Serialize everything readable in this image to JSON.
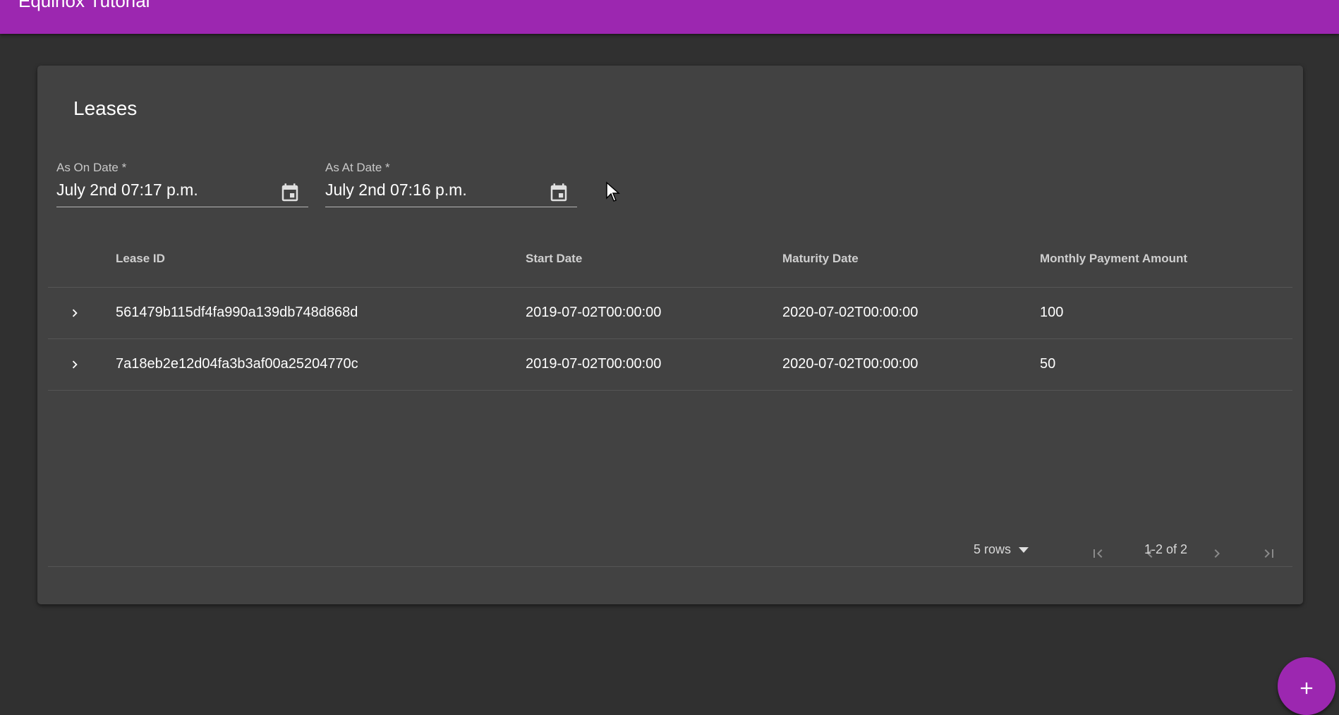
{
  "app": {
    "title": "Equinox Tutorial"
  },
  "card": {
    "title": "Leases"
  },
  "filters": {
    "as_on": {
      "label": "As On Date *",
      "value": "July 2nd 07:17 p.m.",
      "icon": "calendar-icon"
    },
    "as_at": {
      "label": "As At Date *",
      "value": "July 2nd 07:16 p.m.",
      "icon": "calendar-icon"
    }
  },
  "table": {
    "columns": [
      "Lease ID",
      "Start Date",
      "Maturity Date",
      "Monthly Payment Amount"
    ],
    "rows": [
      {
        "lease_id": "561479b115df4fa990a139db748d868d",
        "start": "2019-07-02T00:00:00",
        "maturity": "2020-07-02T00:00:00",
        "amount": "100"
      },
      {
        "lease_id": "7a18eb2e12d04fa3b3af00a25204770c",
        "start": "2019-07-02T00:00:00",
        "maturity": "2020-07-02T00:00:00",
        "amount": "50"
      }
    ]
  },
  "pagination": {
    "rows_per_page": "5 rows",
    "range": "1-2 of 2"
  },
  "colors": {
    "accent": "#9c27b0",
    "background": "#303030",
    "surface": "#424242"
  }
}
